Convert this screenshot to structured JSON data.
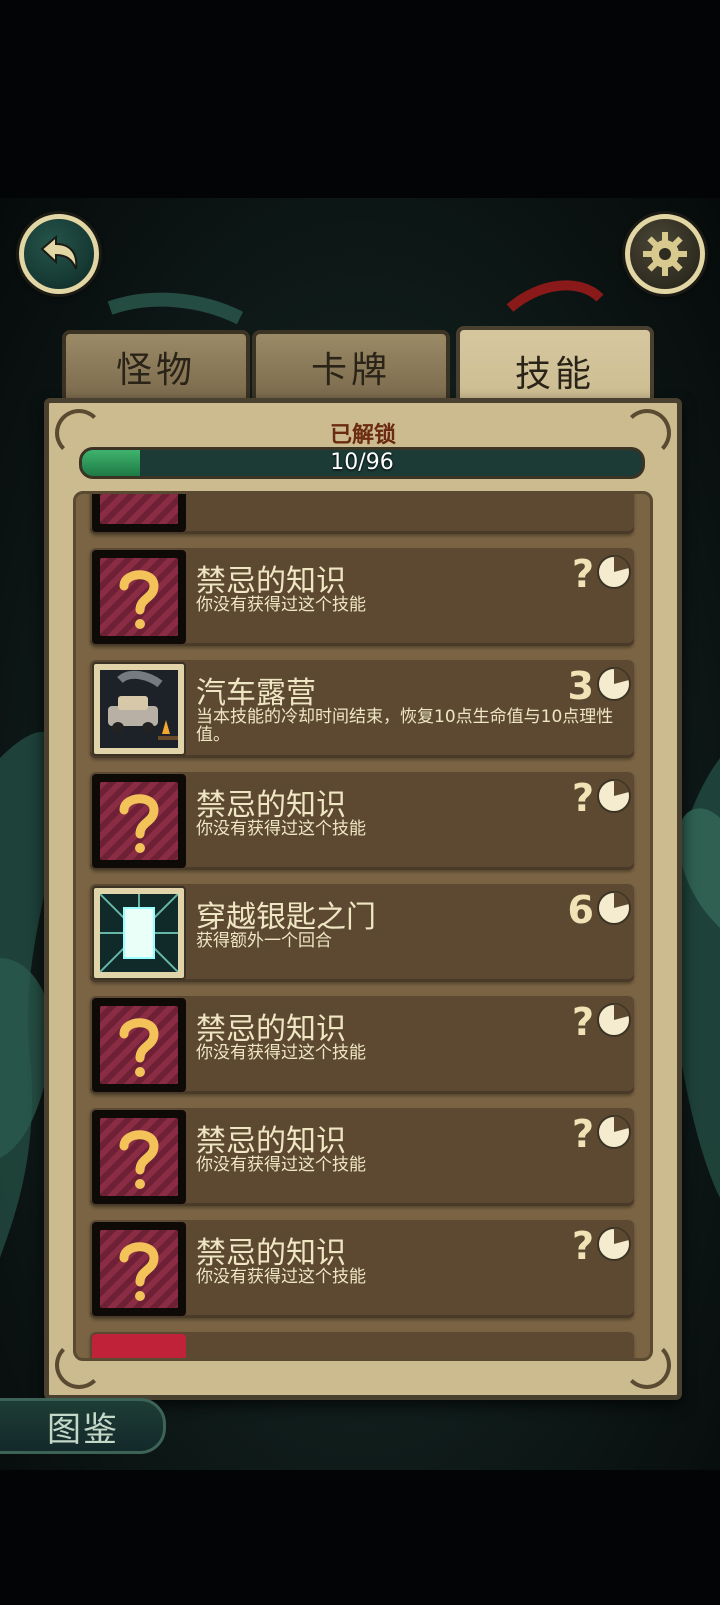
{
  "top_bar": {
    "back_icon": "back-arrow-icon",
    "settings_icon": "gear-icon"
  },
  "tabs": [
    {
      "label": "怪物",
      "active": false
    },
    {
      "label": "卡牌",
      "active": false
    },
    {
      "label": "技能",
      "active": true
    }
  ],
  "panel": {
    "title": "已解锁",
    "progress_text": "10/96",
    "unlocked": 10,
    "total": 96
  },
  "skills": [
    {
      "name": "禁忌的知识",
      "desc": "你没有获得过这个技能",
      "cooldown": "?",
      "locked": true,
      "icon": "question-mark-icon"
    },
    {
      "name": "汽车露营",
      "desc": "当本技能的冷却时间结束，恢复10点生命值与10点理性值。",
      "cooldown": "3",
      "locked": false,
      "icon": "car-campfire-icon"
    },
    {
      "name": "禁忌的知识",
      "desc": "你没有获得过这个技能",
      "cooldown": "?",
      "locked": true,
      "icon": "question-mark-icon"
    },
    {
      "name": "穿越银匙之门",
      "desc": "获得额外一个回合",
      "cooldown": "6",
      "locked": false,
      "icon": "glowing-gate-icon"
    },
    {
      "name": "禁忌的知识",
      "desc": "你没有获得过这个技能",
      "cooldown": "?",
      "locked": true,
      "icon": "question-mark-icon"
    },
    {
      "name": "禁忌的知识",
      "desc": "你没有获得过这个技能",
      "cooldown": "?",
      "locked": true,
      "icon": "question-mark-icon"
    },
    {
      "name": "禁忌的知识",
      "desc": "你没有获得过这个技能",
      "cooldown": "?",
      "locked": true,
      "icon": "question-mark-icon"
    }
  ],
  "bottom": {
    "dex_label": "图鉴"
  },
  "colors": {
    "panel": "#cbbb8f",
    "row": "#5d4932",
    "text": "#efe6c4",
    "locked_icon": "#8a2c44",
    "progress": "#3fb36d",
    "title": "#6b2a12"
  }
}
